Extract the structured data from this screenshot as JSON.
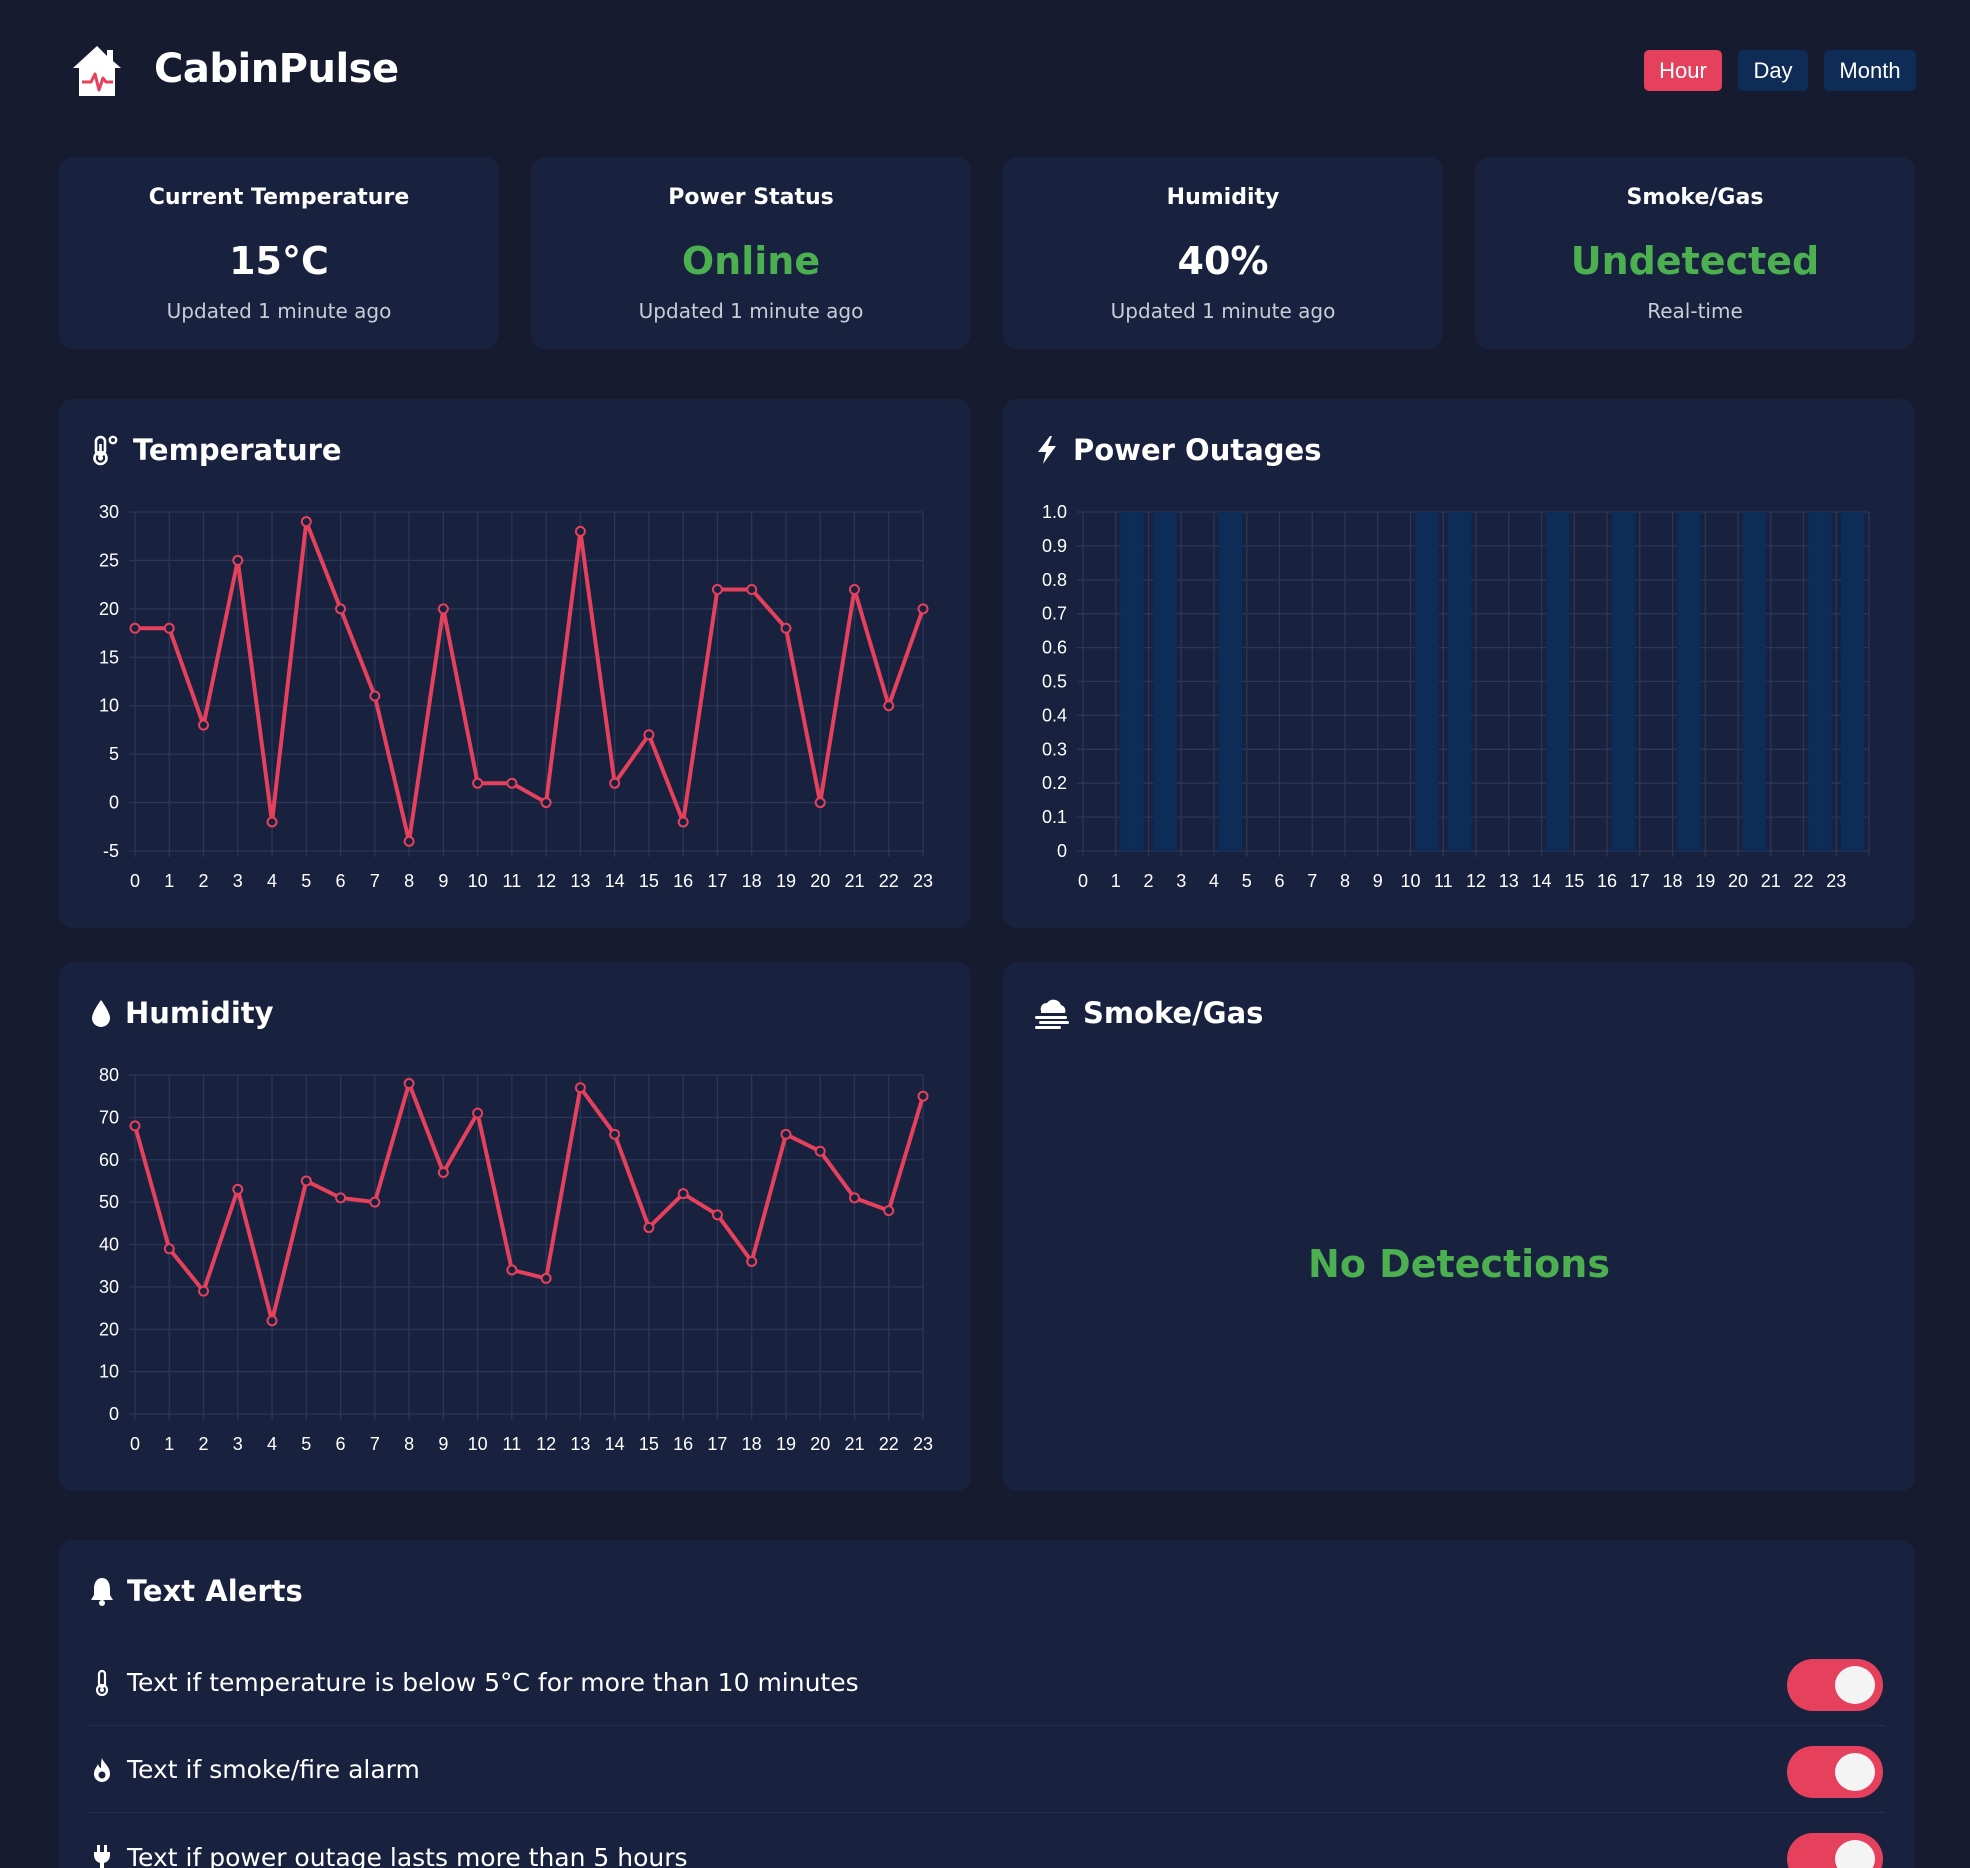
{
  "app": {
    "title": "CabinPulse"
  },
  "range": {
    "hour": "Hour",
    "day": "Day",
    "month": "Month",
    "selected": "Hour"
  },
  "colors": {
    "accent": "#e5415d",
    "ok": "#4caf50",
    "card": "#18213e",
    "bg": "#161b30",
    "bar": "#0d2c57",
    "btn": "#0f2c56"
  },
  "stats": [
    {
      "title": "Current Temperature",
      "value": "15°C",
      "sub": "Updated 1 minute ago",
      "status": "normal"
    },
    {
      "title": "Power Status",
      "value": "Online",
      "sub": "Updated 1 minute ago",
      "status": "ok"
    },
    {
      "title": "Humidity",
      "value": "40%",
      "sub": "Updated 1 minute ago",
      "status": "normal"
    },
    {
      "title": "Smoke/Gas",
      "value": "Undetected",
      "sub": "Real-time",
      "status": "ok"
    }
  ],
  "panels": {
    "temperature": {
      "title": "Temperature",
      "icon": "thermometer-icon"
    },
    "power": {
      "title": "Power Outages",
      "icon": "bolt-icon"
    },
    "humidity": {
      "title": "Humidity",
      "icon": "droplet-icon"
    },
    "smoke": {
      "title": "Smoke/Gas",
      "icon": "smog-icon",
      "message": "No Detections"
    }
  },
  "chart_data": [
    {
      "id": "temperature",
      "type": "line",
      "x": [
        0,
        1,
        2,
        3,
        4,
        5,
        6,
        7,
        8,
        9,
        10,
        11,
        12,
        13,
        14,
        15,
        16,
        17,
        18,
        19,
        20,
        21,
        22,
        23
      ],
      "values": [
        18,
        18,
        8,
        25,
        -2,
        29,
        20,
        11,
        -4,
        20,
        2,
        2,
        0,
        28,
        2,
        7,
        -2,
        22,
        22,
        18,
        0,
        22,
        10,
        20
      ],
      "ylim": [
        -5,
        30
      ],
      "yticks": [
        -5,
        0,
        5,
        10,
        15,
        20,
        25,
        30
      ],
      "grid": true,
      "color": "#e5415d"
    },
    {
      "id": "power",
      "type": "bar",
      "x": [
        0,
        1,
        2,
        3,
        4,
        5,
        6,
        7,
        8,
        9,
        10,
        11,
        12,
        13,
        14,
        15,
        16,
        17,
        18,
        19,
        20,
        21,
        22,
        23
      ],
      "values": [
        0,
        1,
        1,
        0,
        1,
        0,
        0,
        0,
        0,
        0,
        1,
        1,
        0,
        0,
        1,
        0,
        1,
        0,
        1,
        0,
        1,
        0,
        1,
        1
      ],
      "ylim": [
        0,
        1
      ],
      "yticks": [
        "0",
        "0.1",
        "0.2",
        "0.3",
        "0.4",
        "0.5",
        "0.6",
        "0.7",
        "0.8",
        "0.9",
        "1.0"
      ],
      "grid": true,
      "color": "#0d2c57"
    },
    {
      "id": "humidity",
      "type": "line",
      "x": [
        0,
        1,
        2,
        3,
        4,
        5,
        6,
        7,
        8,
        9,
        10,
        11,
        12,
        13,
        14,
        15,
        16,
        17,
        18,
        19,
        20,
        21,
        22,
        23
      ],
      "values": [
        68,
        39,
        29,
        53,
        22,
        55,
        51,
        50,
        78,
        57,
        71,
        34,
        32,
        77,
        66,
        44,
        52,
        47,
        36,
        66,
        62,
        51,
        48,
        75
      ],
      "ylim": [
        0,
        80
      ],
      "yticks": [
        0,
        10,
        20,
        30,
        40,
        50,
        60,
        70,
        80
      ],
      "grid": true,
      "color": "#e5415d"
    }
  ],
  "alerts": {
    "title": "Text Alerts",
    "items": [
      {
        "label": "Text if temperature is below 5°C for more than 10 minutes",
        "icon": "thermometer-icon",
        "enabled": true
      },
      {
        "label": "Text if smoke/fire alarm",
        "icon": "fire-icon",
        "enabled": true
      },
      {
        "label": "Text if power outage lasts more than 5 hours",
        "icon": "plug-icon",
        "enabled": true
      }
    ]
  }
}
